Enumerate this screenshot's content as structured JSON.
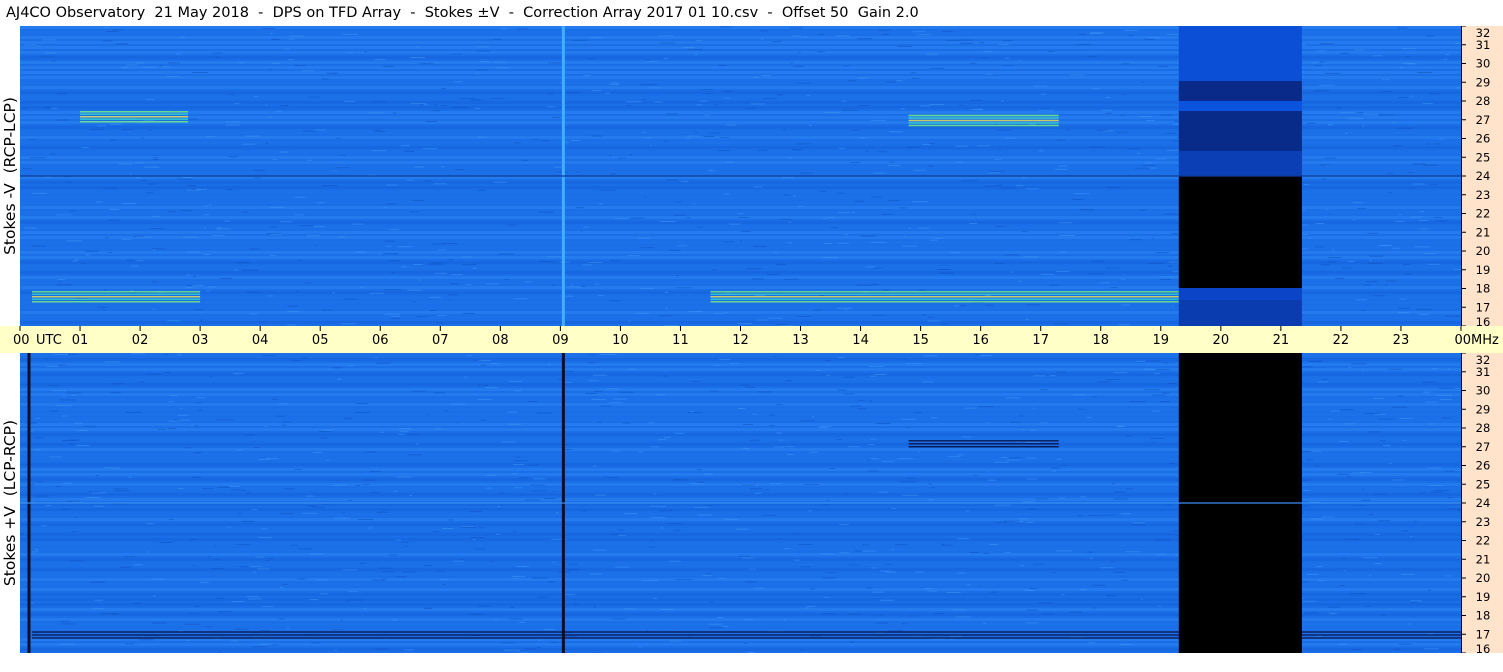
{
  "title": "AJ4CO Observatory  21 May 2018  -  DPS on TFD Array  -  Stokes ±V  -  Correction Array 2017 01 10.csv  -  Offset 50  Gain 2.0",
  "colors": {
    "time_axis_bg": "#ffffc8",
    "freq_axis_bg": "#ffe3cb",
    "spectrogram_base": "#1a6ee8",
    "no_data": "#000000"
  },
  "chart_data": [
    {
      "type": "heatmap",
      "panel": "top",
      "ylabel": "Stokes -V  (RCP-LCP)",
      "x_unit": "UTC",
      "xlim": [
        0,
        24
      ],
      "y_unit": "MHz",
      "ylim": [
        16,
        32
      ],
      "y_ticks": [
        "32",
        "31",
        "30",
        "29",
        "28",
        "27",
        "26",
        "25",
        "24",
        "23",
        "22",
        "21",
        "20",
        "19",
        "18",
        "17",
        "16"
      ],
      "no_data_interval_utc": [
        19.3,
        21.35
      ],
      "features": [
        {
          "label": "emission band",
          "utc": [
            1.0,
            2.8
          ],
          "mhz": 27.2
        },
        {
          "label": "emission band",
          "utc": [
            14.8,
            17.3
          ],
          "mhz": 27.0
        },
        {
          "label": "emission band",
          "utc": [
            11.5,
            19.3
          ],
          "mhz": 17.6
        },
        {
          "label": "emission band",
          "utc": [
            0.2,
            3.0
          ],
          "mhz": 17.6
        },
        {
          "label": "vertical line",
          "utc": [
            9.05,
            9.05
          ],
          "mhz": 24
        }
      ]
    },
    {
      "type": "heatmap",
      "panel": "bottom",
      "ylabel": "Stokes +V  (LCP-RCP)",
      "x_unit": "UTC",
      "xlim": [
        0,
        24
      ],
      "y_unit": "MHz",
      "ylim": [
        16,
        32
      ],
      "y_ticks": [
        "32",
        "31",
        "30",
        "29",
        "28",
        "27",
        "26",
        "25",
        "24",
        "23",
        "22",
        "21",
        "20",
        "19",
        "18",
        "17",
        "16"
      ],
      "no_data_interval_utc": [
        19.3,
        21.35
      ],
      "features": [
        {
          "label": "dark band",
          "utc": [
            14.8,
            17.3
          ],
          "mhz": 27.2
        },
        {
          "label": "dark band",
          "utc": [
            0.2,
            24
          ],
          "mhz": 17.0
        },
        {
          "label": "dark vertical line",
          "utc": [
            9.05,
            9.05
          ],
          "mhz": 24
        },
        {
          "label": "dark vertical line",
          "utc": [
            0.15,
            0.15
          ],
          "mhz": 24
        }
      ]
    }
  ],
  "time_axis": {
    "labels": [
      "00",
      "01",
      "02",
      "03",
      "04",
      "05",
      "06",
      "07",
      "08",
      "09",
      "10",
      "11",
      "12",
      "13",
      "14",
      "15",
      "16",
      "17",
      "18",
      "19",
      "20",
      "21",
      "22",
      "23",
      "00"
    ],
    "utc_label": "UTC",
    "mhz_label": "MHz"
  }
}
